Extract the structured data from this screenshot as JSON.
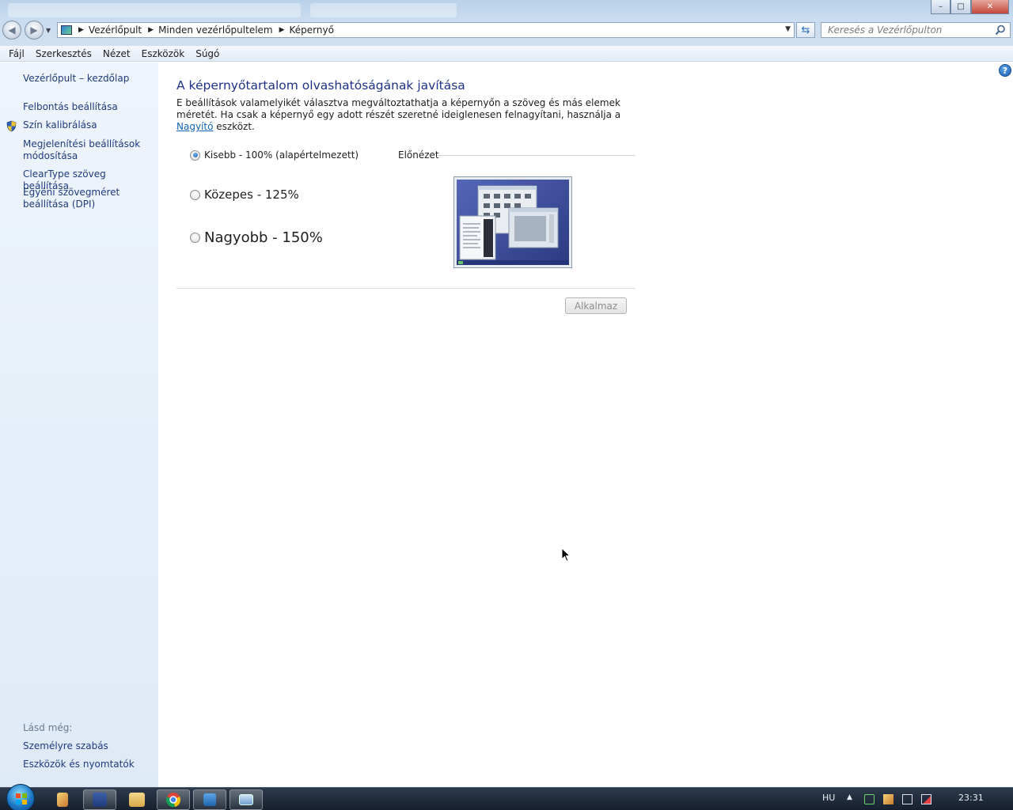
{
  "window": {
    "controls": {
      "minimize": "–",
      "maximize": "□",
      "close": "✕"
    }
  },
  "address": {
    "crumbs": [
      "Vezérlőpult",
      "Minden vezérlőpultelem",
      "Képernyő"
    ],
    "search_placeholder": "Keresés a Vezérlőpulton"
  },
  "menu": [
    "Fájl",
    "Szerkesztés",
    "Nézet",
    "Eszközök",
    "Súgó"
  ],
  "sidebar": {
    "home": "Vezérlőpult – kezdőlap",
    "links": [
      "Felbontás beállítása",
      "Szín kalibrálása",
      "Megjelenítési beállítások módosítása",
      "ClearType szöveg beállítása",
      "Egyéni szövegméret beállítása (DPI)"
    ],
    "see_also_label": "Lásd még:",
    "see_also": [
      "Személyre szabás",
      "Eszközök és nyomtatók"
    ]
  },
  "main": {
    "title": "A képernyőtartalom olvashatóságának javítása",
    "desc_before": "E beállítások valamelyikét választva megváltoztathatja a képernyőn a szöveg és más elemek méretét. Ha csak a képernyő egy adott részét szeretné ideiglenesen felnagyítani, használja a ",
    "desc_link": "Nagyító",
    "desc_after": " eszközt.",
    "options": [
      {
        "label": "Kisebb - 100% (alapértelmezett)",
        "checked": true
      },
      {
        "label": "Közepes - 125%",
        "checked": false
      },
      {
        "label": "Nagyobb - 150%",
        "checked": false
      }
    ],
    "preview_label": "Előnézet",
    "apply_label": "Alkalmaz"
  },
  "taskbar": {
    "language": "HU",
    "clock": "23:31"
  },
  "colors": {
    "link": "#1f3b7c",
    "title": "#1e3287",
    "sidebar_bg": "#e6eef8"
  }
}
